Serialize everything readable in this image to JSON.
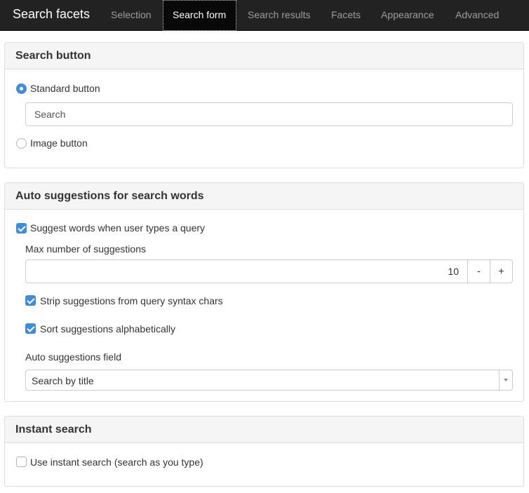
{
  "navbar": {
    "brand": "Search facets",
    "tabs": [
      {
        "label": "Selection",
        "active": false
      },
      {
        "label": "Search form",
        "active": true
      },
      {
        "label": "Search results",
        "active": false
      },
      {
        "label": "Facets",
        "active": false
      },
      {
        "label": "Appearance",
        "active": false
      },
      {
        "label": "Advanced",
        "active": false
      }
    ]
  },
  "search_button_panel": {
    "title": "Search button",
    "standard_option": {
      "label": "Standard button",
      "selected": true
    },
    "button_text_value": "Search",
    "image_option": {
      "label": "Image button",
      "selected": false
    }
  },
  "suggestions_panel": {
    "title": "Auto suggestions for search words",
    "suggest_checkbox": {
      "label": "Suggest words when user types a query",
      "checked": true
    },
    "max_label": "Max number of suggestions",
    "max_value": "10",
    "decrement_label": "-",
    "increment_label": "+",
    "strip_checkbox": {
      "label": "Strip suggestions from query syntax chars",
      "checked": true
    },
    "sort_checkbox": {
      "label": "Sort suggestions alphabetically",
      "checked": true
    },
    "field_label": "Auto suggestions field",
    "field_selected": "Search by title"
  },
  "instant_panel": {
    "title": "Instant search",
    "instant_checkbox": {
      "label": "Use instant search (search as you type)",
      "checked": false
    }
  },
  "colors": {
    "navbar_bg": "#222222",
    "accent": "#3e8ddd",
    "panel_heading_bg": "#f5f5f5"
  }
}
